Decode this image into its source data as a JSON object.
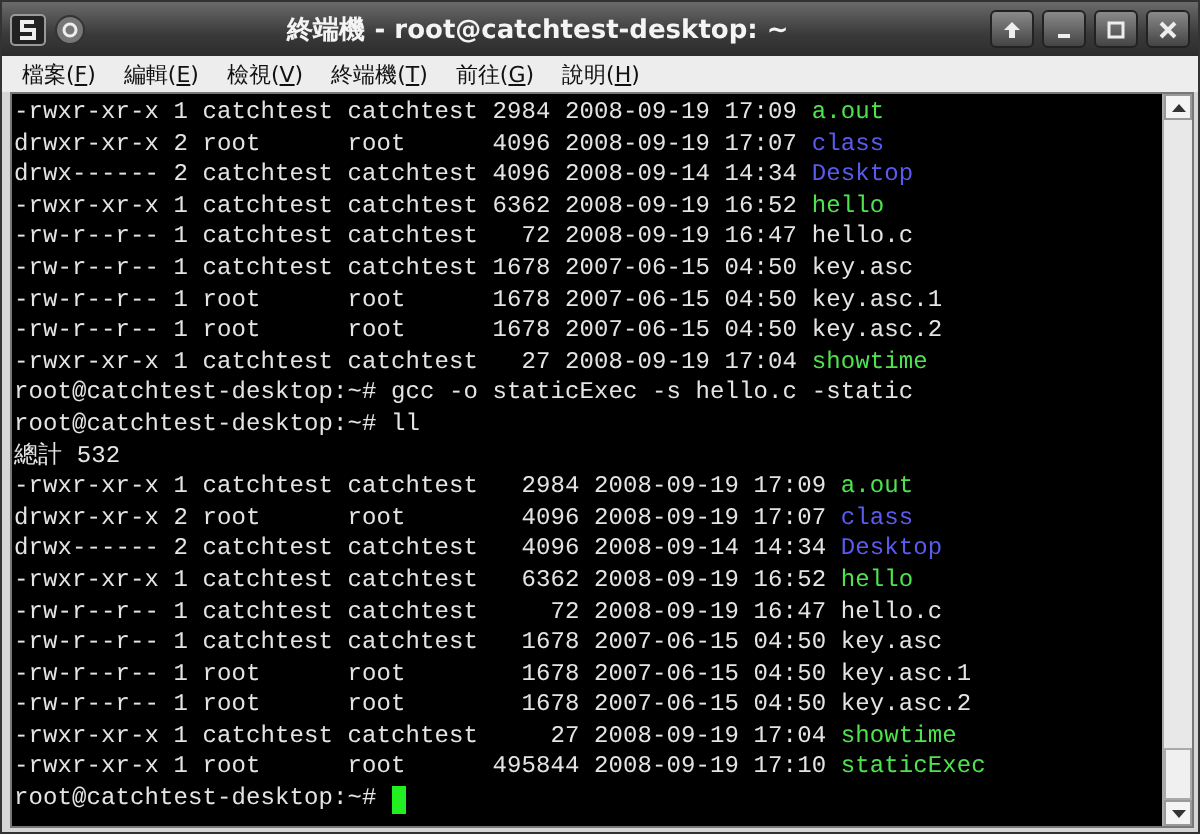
{
  "window": {
    "title": "終端機 - root@catchtest-desktop: ~"
  },
  "menu": [
    {
      "label": "檔案(F)"
    },
    {
      "label": "編輯(E)"
    },
    {
      "label": "檢視(V)"
    },
    {
      "label": "終端機(T)"
    },
    {
      "label": "前往(G)"
    },
    {
      "label": "說明(H)"
    }
  ],
  "terminal": {
    "lines": [
      {
        "text": "-rwxr-xr-x 1 catchtest catchtest 2984 2008-09-19 17:09 ",
        "file": "a.out",
        "kind": "exec"
      },
      {
        "text": "drwxr-xr-x 2 root      root      4096 2008-09-19 17:07 ",
        "file": "class",
        "kind": "dir"
      },
      {
        "text": "drwx------ 2 catchtest catchtest 4096 2008-09-14 14:34 ",
        "file": "Desktop",
        "kind": "dir"
      },
      {
        "text": "-rwxr-xr-x 1 catchtest catchtest 6362 2008-09-19 16:52 ",
        "file": "hello",
        "kind": "exec"
      },
      {
        "text": "-rw-r--r-- 1 catchtest catchtest   72 2008-09-19 16:47 ",
        "file": "hello.c",
        "kind": "plain"
      },
      {
        "text": "-rw-r--r-- 1 catchtest catchtest 1678 2007-06-15 04:50 ",
        "file": "key.asc",
        "kind": "plain"
      },
      {
        "text": "-rw-r--r-- 1 root      root      1678 2007-06-15 04:50 ",
        "file": "key.asc.1",
        "kind": "plain"
      },
      {
        "text": "-rw-r--r-- 1 root      root      1678 2007-06-15 04:50 ",
        "file": "key.asc.2",
        "kind": "plain"
      },
      {
        "text": "-rwxr-xr-x 1 catchtest catchtest   27 2008-09-19 17:04 ",
        "file": "showtime",
        "kind": "exec"
      },
      {
        "text": "root@catchtest-desktop:~# gcc -o staticExec -s hello.c -static"
      },
      {
        "text": "root@catchtest-desktop:~# ll"
      },
      {
        "text": "總計 532"
      },
      {
        "text": "-rwxr-xr-x 1 catchtest catchtest   2984 2008-09-19 17:09 ",
        "file": "a.out",
        "kind": "exec"
      },
      {
        "text": "drwxr-xr-x 2 root      root        4096 2008-09-19 17:07 ",
        "file": "class",
        "kind": "dir"
      },
      {
        "text": "drwx------ 2 catchtest catchtest   4096 2008-09-14 14:34 ",
        "file": "Desktop",
        "kind": "dir"
      },
      {
        "text": "-rwxr-xr-x 1 catchtest catchtest   6362 2008-09-19 16:52 ",
        "file": "hello",
        "kind": "exec"
      },
      {
        "text": "-rw-r--r-- 1 catchtest catchtest     72 2008-09-19 16:47 ",
        "file": "hello.c",
        "kind": "plain"
      },
      {
        "text": "-rw-r--r-- 1 catchtest catchtest   1678 2007-06-15 04:50 ",
        "file": "key.asc",
        "kind": "plain"
      },
      {
        "text": "-rw-r--r-- 1 root      root        1678 2007-06-15 04:50 ",
        "file": "key.asc.1",
        "kind": "plain"
      },
      {
        "text": "-rw-r--r-- 1 root      root        1678 2007-06-15 04:50 ",
        "file": "key.asc.2",
        "kind": "plain"
      },
      {
        "text": "-rwxr-xr-x 1 catchtest catchtest     27 2008-09-19 17:04 ",
        "file": "showtime",
        "kind": "exec"
      },
      {
        "text": "-rwxr-xr-x 1 root      root      495844 2008-09-19 17:10 ",
        "file": "staticExec",
        "kind": "exec"
      },
      {
        "text": "root@catchtest-desktop:~# ",
        "cursor": true
      }
    ]
  }
}
